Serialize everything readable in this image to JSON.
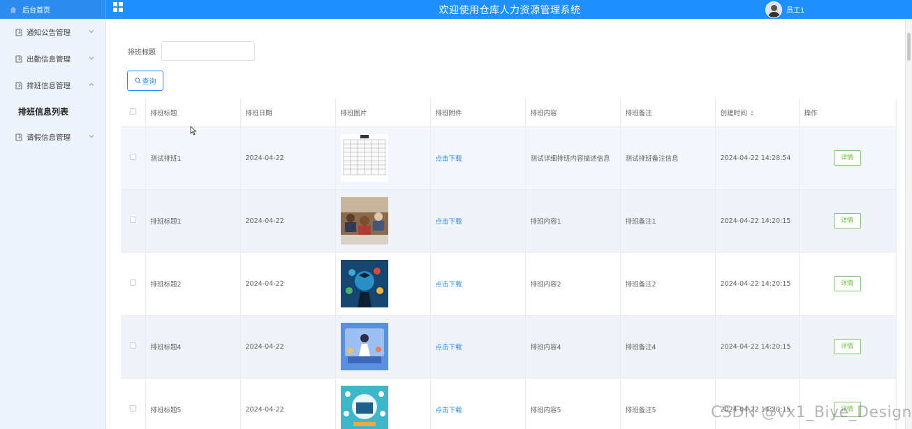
{
  "topbar": {
    "brand_label": "后台首页",
    "title": "欢迎使用仓库人力资源管理系统",
    "user_name": "员工1"
  },
  "sidebar": {
    "items": [
      {
        "label": "通知公告管理",
        "expanded": false
      },
      {
        "label": "出勤信息管理",
        "expanded": false
      },
      {
        "label": "排班信息管理",
        "expanded": true
      },
      {
        "label": "请假信息管理",
        "expanded": false
      }
    ],
    "active_sub_item": "排班信息列表"
  },
  "search": {
    "label": "排班标题",
    "value": "",
    "placeholder": "",
    "button_label": "查询"
  },
  "table": {
    "columns": [
      "排班标题",
      "排班日期",
      "排班图片",
      "排班附件",
      "排班内容",
      "排班备注",
      "创建时间",
      "操作"
    ],
    "rows": [
      {
        "title": "测试排班1",
        "date": "2024-04-22",
        "image": "schedule-sheet",
        "attachment": "点击下载",
        "content": "测试详细排班内容描述信息",
        "remark": "测试排班备注信息",
        "created": "2024-04-22 14:28:54",
        "action": "详情"
      },
      {
        "title": "排班标题1",
        "date": "2024-04-22",
        "image": "classroom-photo",
        "attachment": "点击下载",
        "content": "排班内容1",
        "remark": "排班备注1",
        "created": "2024-04-22 14:20:15",
        "action": "详情"
      },
      {
        "title": "排班标题2",
        "date": "2024-04-22",
        "image": "graduate-icons",
        "attachment": "点击下载",
        "content": "排班内容2",
        "remark": "排班备注2",
        "created": "2024-04-22 14:20:15",
        "action": "详情"
      },
      {
        "title": "排班标题4",
        "date": "2024-04-22",
        "image": "teacher-illustration",
        "attachment": "点击下载",
        "content": "排班内容4",
        "remark": "排班备注4",
        "created": "2024-04-22 14:20:15",
        "action": "详情"
      },
      {
        "title": "排班标题5",
        "date": "2024-04-22",
        "image": "online-education",
        "attachment": "点击下载",
        "content": "排班内容5",
        "remark": "排班备注5",
        "created": "2024-04-22 14:20:15",
        "action": "详情"
      }
    ]
  },
  "watermark": "CSDN @vx1_Biye_Design",
  "colors": {
    "primary": "#1e90ff",
    "link": "#2d8cf0",
    "success": "#67c23a",
    "sidebar_bg": "#eef4fb"
  }
}
